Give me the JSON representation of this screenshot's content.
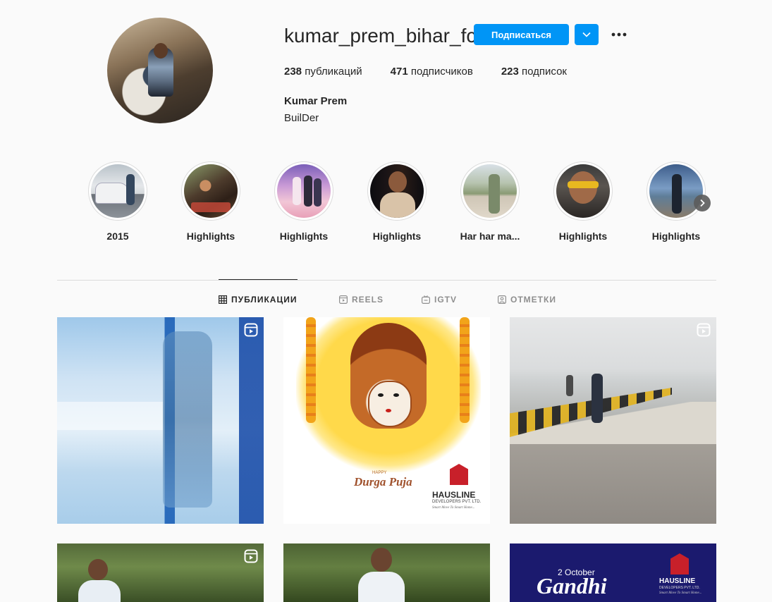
{
  "profile": {
    "username": "kumar_prem_bihar_fc",
    "follow_label": "Подписаться",
    "full_name": "Kumar Prem",
    "bio": "BuilDer",
    "stats": [
      {
        "count": "238",
        "label": "публикаций"
      },
      {
        "count": "471",
        "label": "подписчиков"
      },
      {
        "count": "223",
        "label": "подписок"
      }
    ]
  },
  "highlights": [
    {
      "label": "2015"
    },
    {
      "label": "Highlights"
    },
    {
      "label": "Highlights"
    },
    {
      "label": "Highlights"
    },
    {
      "label": "Har har ma..."
    },
    {
      "label": "Highlights"
    },
    {
      "label": "Highlights"
    }
  ],
  "tabs": [
    {
      "label": "ПУБЛИКАЦИИ",
      "icon": "grid-icon",
      "active": true
    },
    {
      "label": "REELS",
      "icon": "reels-icon",
      "active": false
    },
    {
      "label": "IGTV",
      "icon": "igtv-icon",
      "active": false
    },
    {
      "label": "ОТМЕТКИ",
      "icon": "tagged-icon",
      "active": false
    }
  ],
  "posts": {
    "durga": {
      "small_text": "HAPPY",
      "title": "Durga Puja",
      "brand": "HAUSLINE",
      "brand_sub": "DEVELOPERS PVT. LTD.",
      "tagline": "Smart Move To Smart Home..."
    },
    "gandhi": {
      "date": "2 October",
      "title": "Gandhi",
      "brand": "HAUSLINE",
      "brand_sub": "DEVELOPERS PVT. LTD.",
      "tagline": "Smart Move To Smart Home..."
    }
  },
  "colors": {
    "accent": "#0095f6",
    "text": "#262626",
    "muted": "#8e8e8e",
    "border": "#dbdbdb",
    "background": "#fafafa"
  }
}
